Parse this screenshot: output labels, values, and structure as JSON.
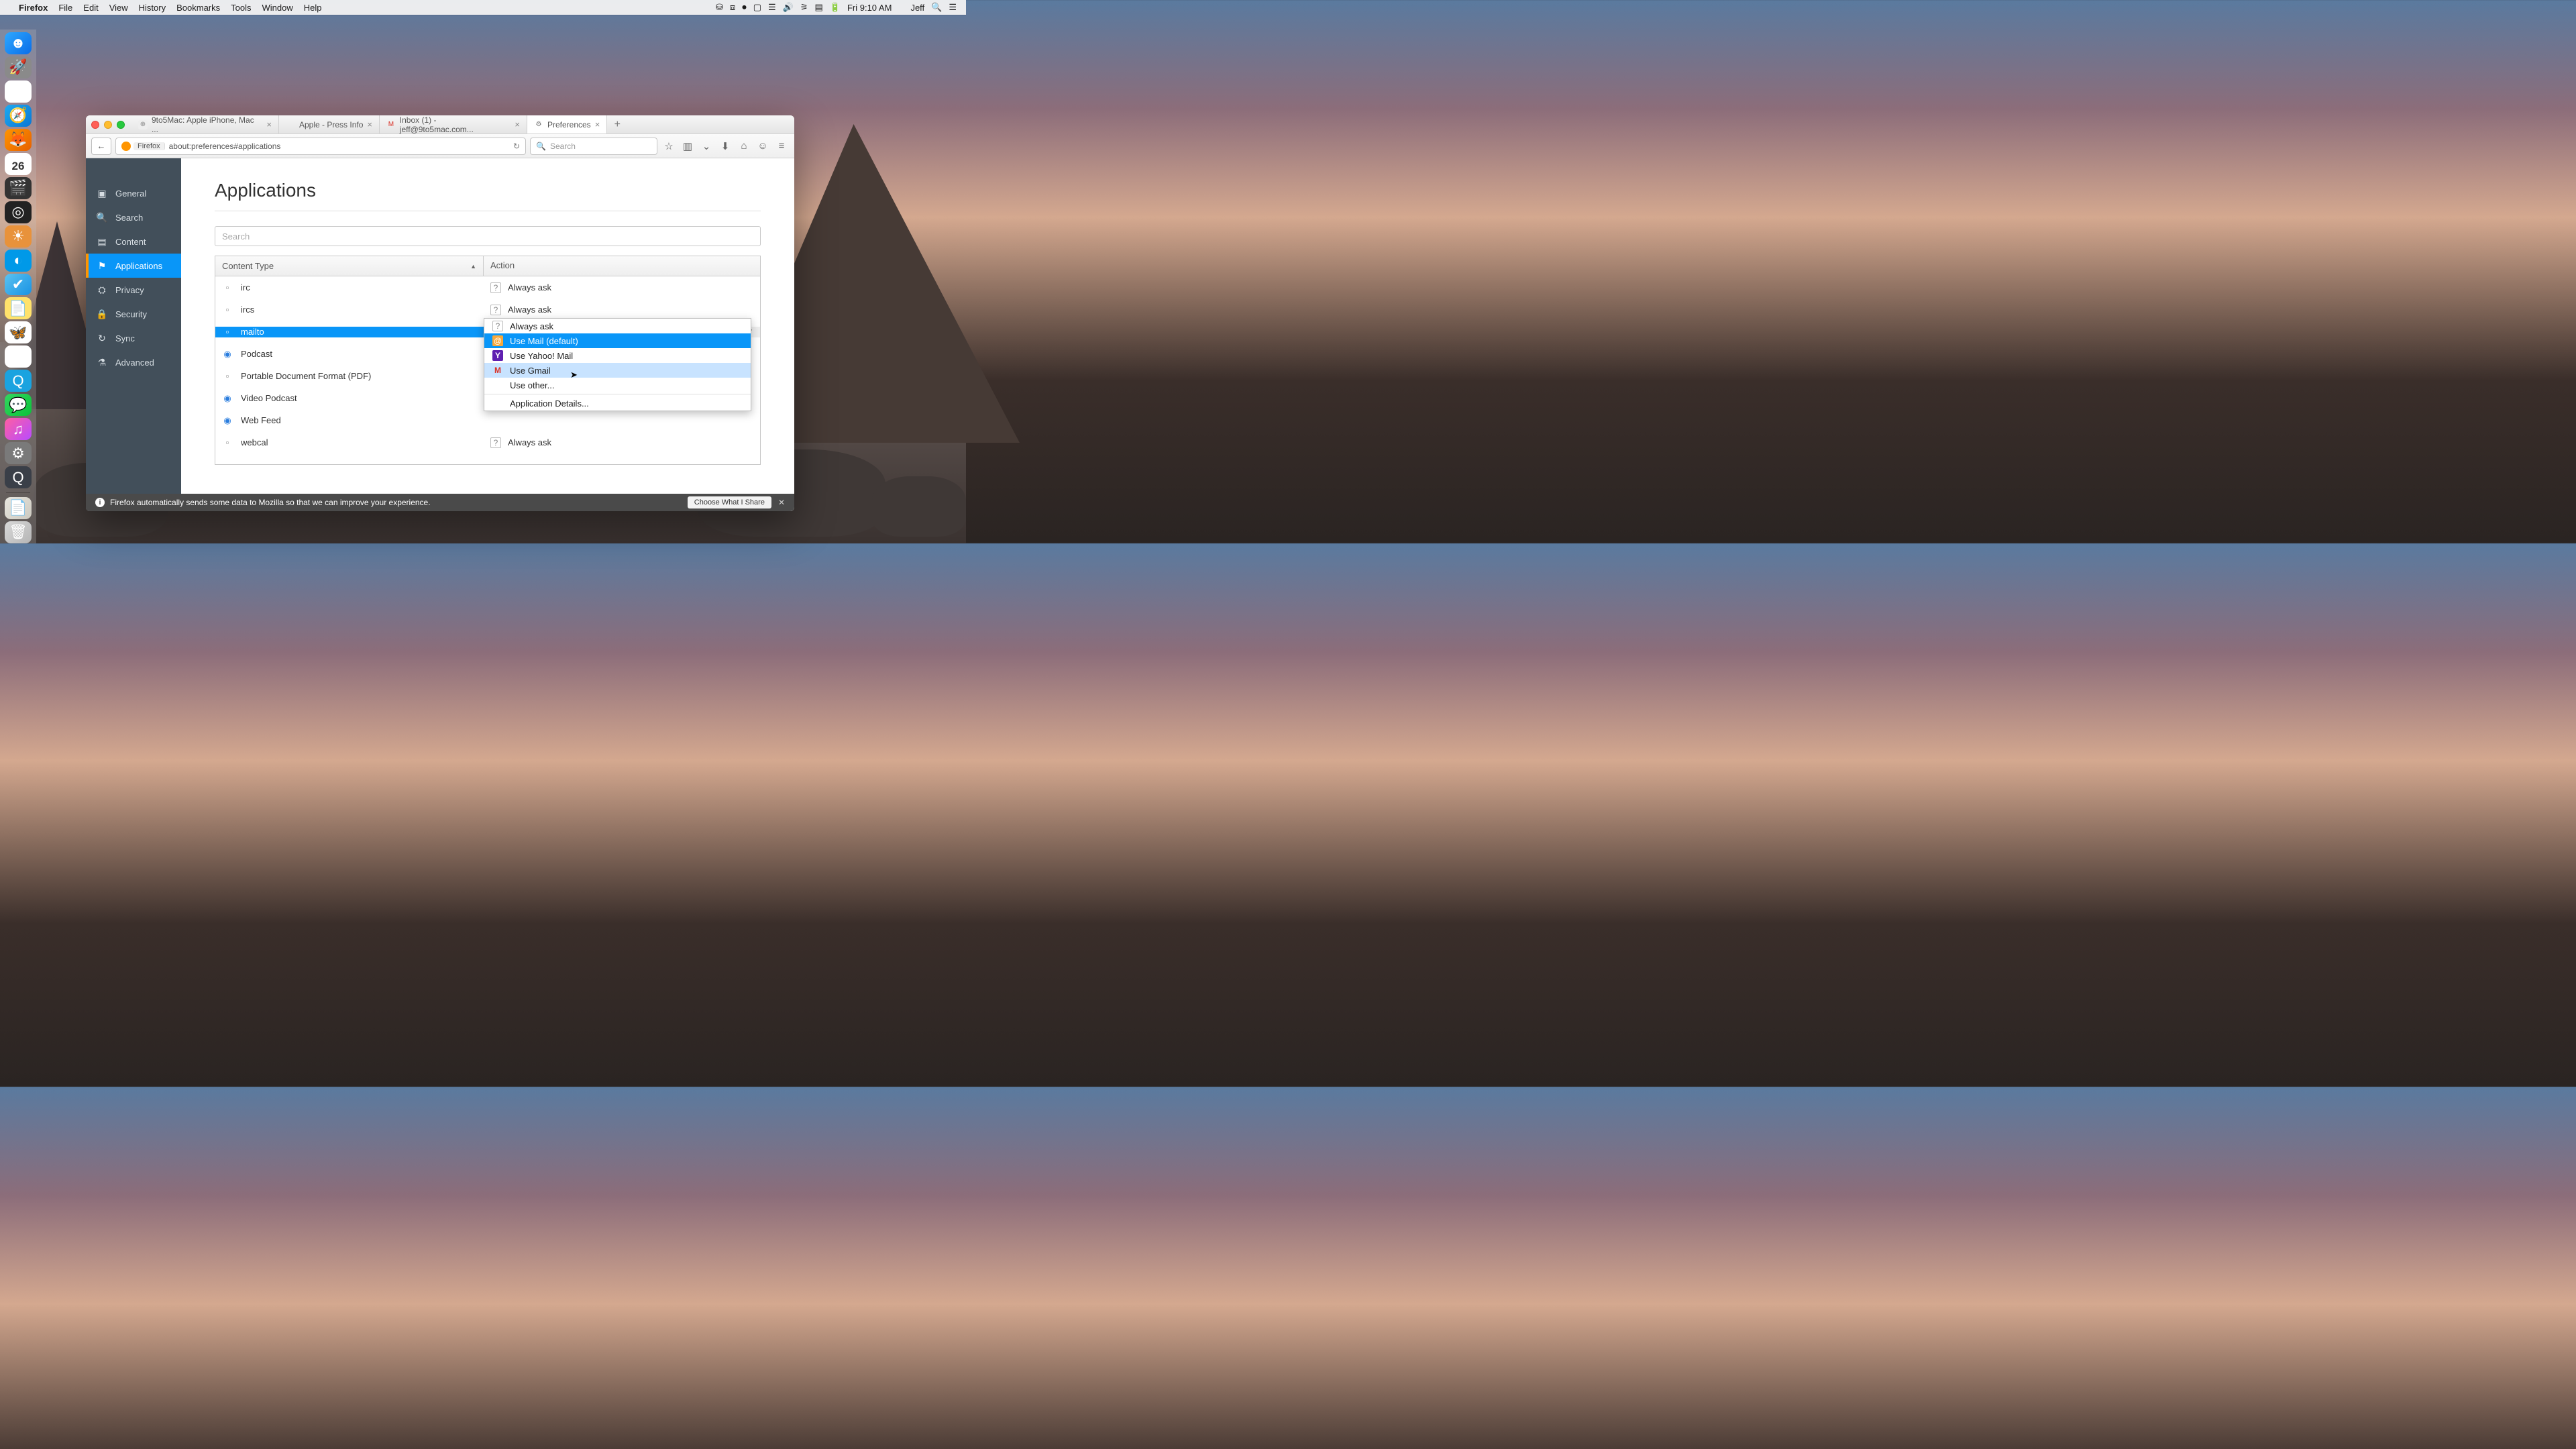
{
  "menubar": {
    "app": "Firefox",
    "items": [
      "File",
      "Edit",
      "View",
      "History",
      "Bookmarks",
      "Tools",
      "Window",
      "Help"
    ],
    "clock": "Fri 9:10 AM",
    "user": "Jeff"
  },
  "dock_calendar_day": "26",
  "tabs": [
    {
      "label": "9to5Mac: Apple iPhone, Mac ...",
      "icon": "globe"
    },
    {
      "label": "Apple - Press Info",
      "icon": "apple"
    },
    {
      "label": "Inbox (1) - jeff@9to5mac.com...",
      "icon": "gmail"
    },
    {
      "label": "Preferences",
      "icon": "gear",
      "active": true
    }
  ],
  "url_identity": "Firefox",
  "url": "about:preferences#applications",
  "search_placeholder": "Search",
  "sidebar": [
    {
      "icon": "general",
      "label": "General"
    },
    {
      "icon": "search",
      "label": "Search"
    },
    {
      "icon": "content",
      "label": "Content"
    },
    {
      "icon": "apps",
      "label": "Applications",
      "active": true
    },
    {
      "icon": "privacy",
      "label": "Privacy"
    },
    {
      "icon": "security",
      "label": "Security"
    },
    {
      "icon": "sync",
      "label": "Sync"
    },
    {
      "icon": "advanced",
      "label": "Advanced"
    }
  ],
  "page_title": "Applications",
  "apps_search_placeholder": "Search",
  "columns": {
    "ct": "Content Type",
    "ac": "Action"
  },
  "rows": [
    {
      "type": "irc",
      "icon": "file",
      "action": "Always ask",
      "aicon": "ask"
    },
    {
      "type": "ircs",
      "icon": "file",
      "action": "Always ask",
      "aicon": "ask"
    },
    {
      "type": "mailto",
      "icon": "file",
      "action": "Use Mail (default)",
      "aicon": "mail",
      "selected": true
    },
    {
      "type": "Podcast",
      "icon": "rss",
      "action": "",
      "aicon": ""
    },
    {
      "type": "Portable Document Format (PDF)",
      "icon": "pdf",
      "action": "",
      "aicon": ""
    },
    {
      "type": "Video Podcast",
      "icon": "rss",
      "action": "",
      "aicon": ""
    },
    {
      "type": "Web Feed",
      "icon": "rss",
      "action": "",
      "aicon": ""
    },
    {
      "type": "webcal",
      "icon": "file",
      "action": "Always ask",
      "aicon": "ask"
    }
  ],
  "dropdown": [
    {
      "label": "Always ask",
      "icon": "ask"
    },
    {
      "label": "Use Mail (default)",
      "icon": "mail",
      "sel": true
    },
    {
      "label": "Use Yahoo! Mail",
      "icon": "yahoo"
    },
    {
      "label": "Use Gmail",
      "icon": "gmail",
      "hover": true
    },
    {
      "label": "Use other...",
      "icon": ""
    },
    {
      "sep": true
    },
    {
      "label": "Application Details...",
      "icon": ""
    }
  ],
  "notif": {
    "text": "Firefox automatically sends some data to Mozilla so that we can improve your experience.",
    "button": "Choose What I Share"
  }
}
